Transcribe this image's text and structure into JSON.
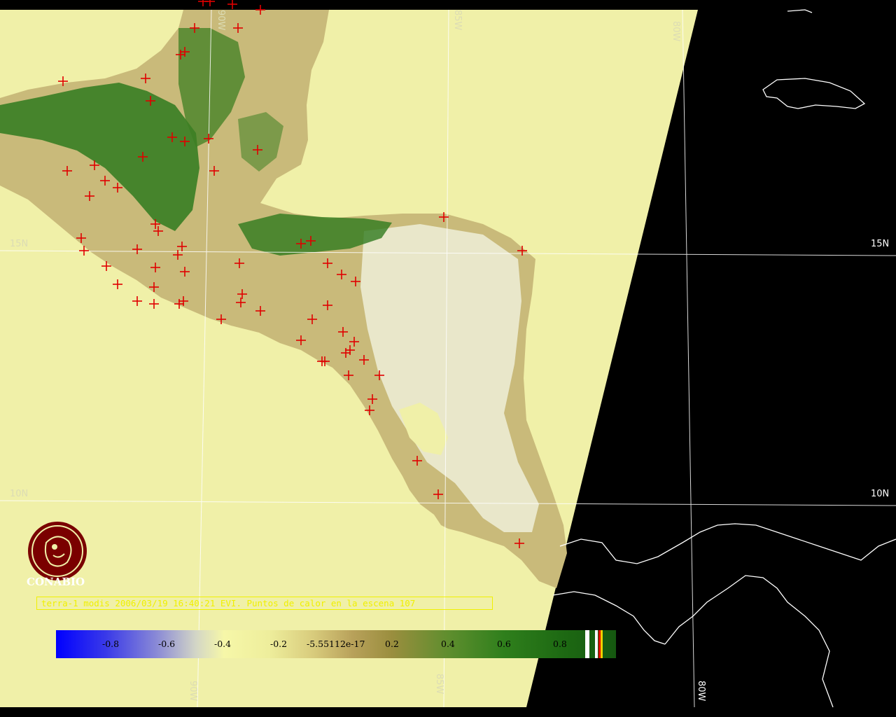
{
  "map": {
    "lat_labels": [
      "15N",
      "15N",
      "10N",
      "10N"
    ],
    "lon_labels_top": [
      "90W",
      "85W",
      "80W"
    ],
    "lon_labels_bottom": [
      "90W",
      "85W",
      "80W"
    ]
  },
  "logo": {
    "text": "CONABIO"
  },
  "caption": {
    "text": "terra-1 modis 2006/03/19 16:40:21 EVI. Puntos de calor en la escena 107"
  },
  "colorbar": {
    "ticks": [
      "-0.8",
      "-0.6",
      "-0.4",
      "-0.2",
      "-5.55112e-17",
      "0.2",
      "0.4",
      "0.6",
      "0.8"
    ]
  },
  "colors": {
    "swath_background": "#f0f0a8",
    "outside_swath": "#000000",
    "hotspot_marker": "#e00000",
    "graticule": "#ffffff",
    "caption_text": "#f0f000",
    "logo": "#7a0000"
  }
}
